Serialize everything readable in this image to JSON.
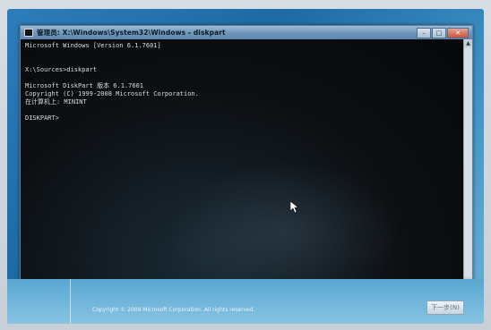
{
  "window": {
    "title": "管理员: X:\\Windows\\System32\\Windows - diskpart",
    "controls": {
      "minimize": "–",
      "maximize": "□",
      "close": "✕"
    }
  },
  "console": {
    "lines": [
      "Microsoft Windows [Version 6.1.7601]",
      "",
      "",
      "X:\\Sources>diskpart",
      "",
      "Microsoft DiskPart 版本 6.1.7601",
      "Copyright (C) 1999-2008 Microsoft Corporation.",
      "在计算机上: MININT",
      "",
      "DISKPART>"
    ]
  },
  "setup": {
    "copyright": "Copyright © 2009 Microsoft Corporation. All rights reserved.",
    "next_button": "下一步(N)"
  },
  "colors": {
    "console_bg": "#0c0c0c",
    "console_text": "#d9dde2",
    "titlebar": "#6e97bb",
    "setup_bg": "#2d7dbb"
  }
}
